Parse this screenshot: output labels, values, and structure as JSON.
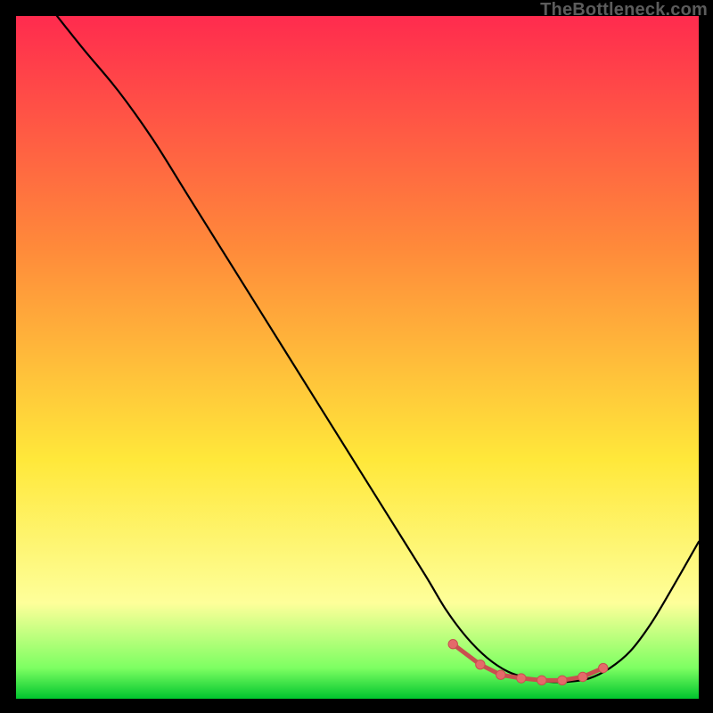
{
  "watermark": "TheBottleneck.com",
  "colors": {
    "top": "#ff2b4e",
    "mid_orange": "#ff8a3a",
    "yellow": "#ffe83a",
    "light_yellow": "#feff9a",
    "green_hi": "#7dff62",
    "green_lo": "#00c52e",
    "curve": "#000000",
    "marker_fill": "#e46a6a",
    "marker_stroke": "#c94f4f"
  },
  "chart_data": {
    "type": "line",
    "title": "",
    "xlabel": "",
    "ylabel": "",
    "xlim": [
      0,
      100
    ],
    "ylim": [
      0,
      100
    ],
    "grid": false,
    "legend": false,
    "series": [
      {
        "name": "bottleneck-curve",
        "x": [
          6,
          10,
          15,
          20,
          25,
          30,
          35,
          40,
          45,
          50,
          55,
          60,
          63,
          66,
          69,
          72,
          75,
          78,
          81,
          84,
          87,
          90,
          93,
          96,
          100
        ],
        "y": [
          100,
          95,
          89,
          82,
          74,
          66,
          58,
          50,
          42,
          34,
          26,
          18,
          13,
          9,
          6,
          4,
          3,
          2.5,
          2.5,
          3,
          4.5,
          7,
          11,
          16,
          23
        ]
      }
    ],
    "markers": {
      "name": "trough-markers",
      "x": [
        64,
        68,
        71,
        74,
        77,
        80,
        83,
        86
      ],
      "y": [
        8,
        5,
        3.5,
        3,
        2.7,
        2.7,
        3.2,
        4.5
      ]
    },
    "annotations": []
  }
}
